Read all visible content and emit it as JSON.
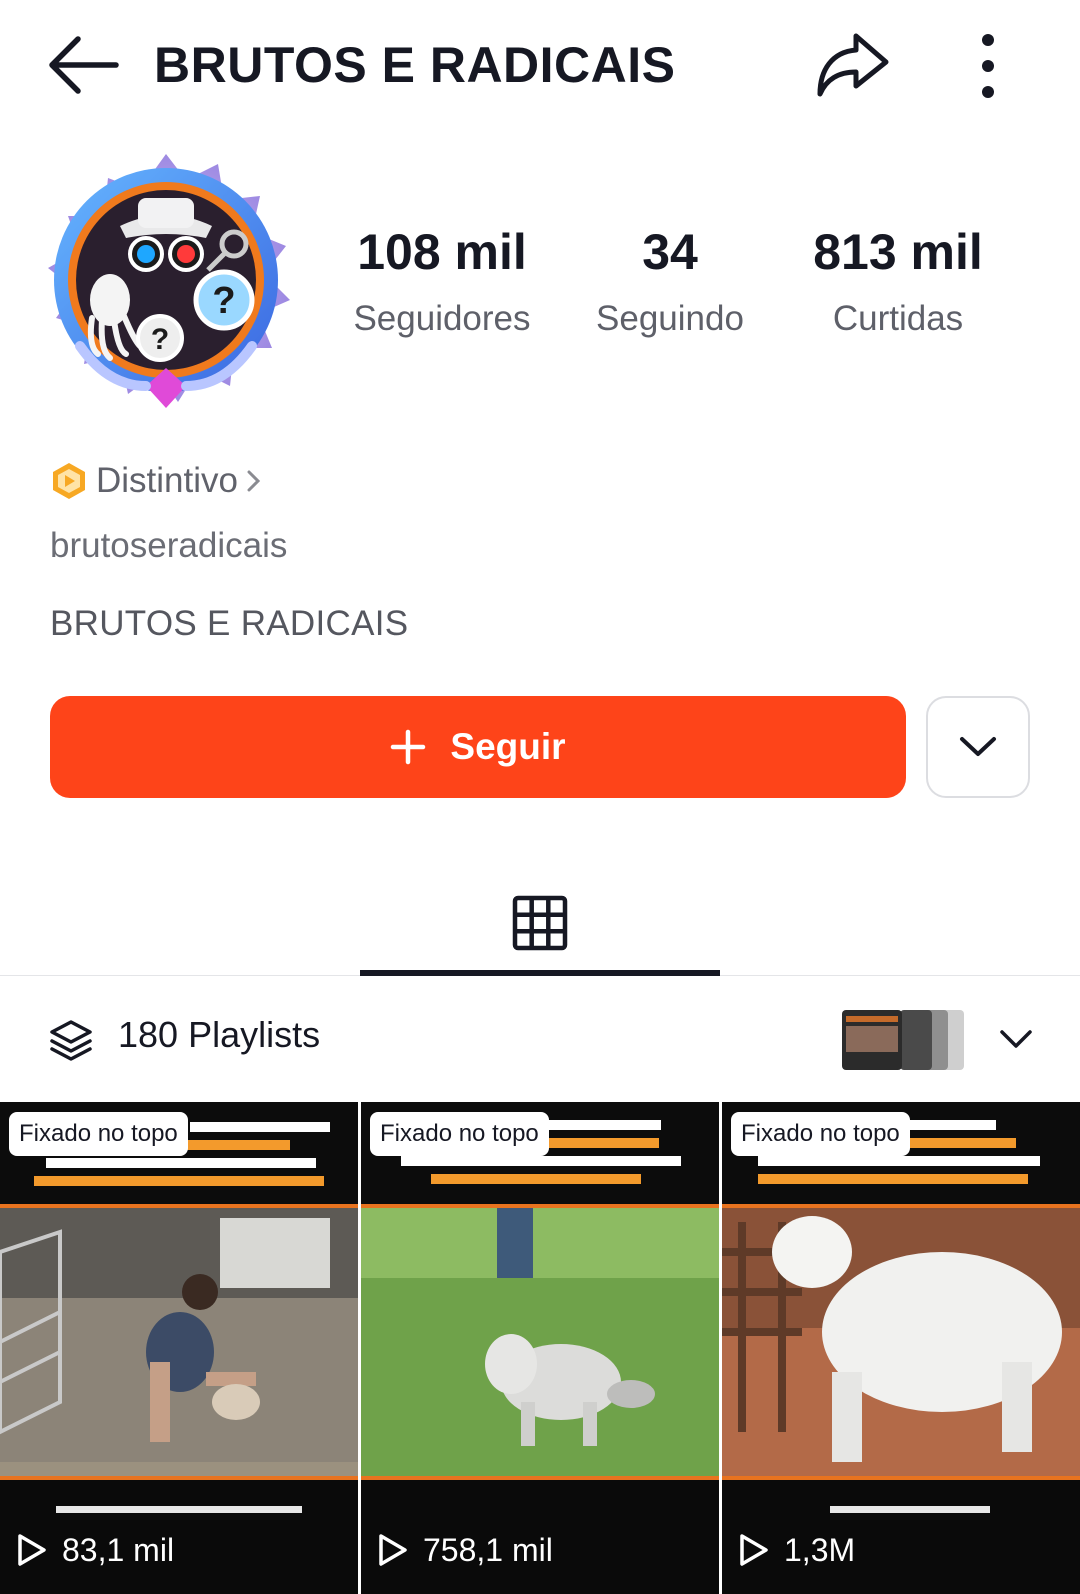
{
  "header": {
    "title": "BRUTOS E RADICAIS",
    "back_icon": "arrow-left-icon",
    "share_icon": "share-arrow-icon",
    "more_icon": "more-vertical-icon"
  },
  "profile": {
    "stats": [
      {
        "value": "108 mil",
        "label": "Seguidores"
      },
      {
        "value": "34",
        "label": "Seguindo"
      },
      {
        "value": "813 mil",
        "label": "Curtidas"
      }
    ],
    "badge_label": "Distintivo",
    "username": "brutoseradicais",
    "bio": "BRUTOS E RADICAIS",
    "follow_label": "Seguir"
  },
  "playlists": {
    "label": "180 Playlists"
  },
  "videos": [
    {
      "pinned_label": "Fixado no topo",
      "views": "83,1 mil"
    },
    {
      "pinned_label": "Fixado no topo",
      "views": "758,1 mil"
    },
    {
      "pinned_label": "Fixado no topo",
      "views": "1,3M"
    }
  ],
  "colors": {
    "accent": "#fe4419",
    "text_primary": "#161823",
    "text_secondary": "#60626b"
  }
}
